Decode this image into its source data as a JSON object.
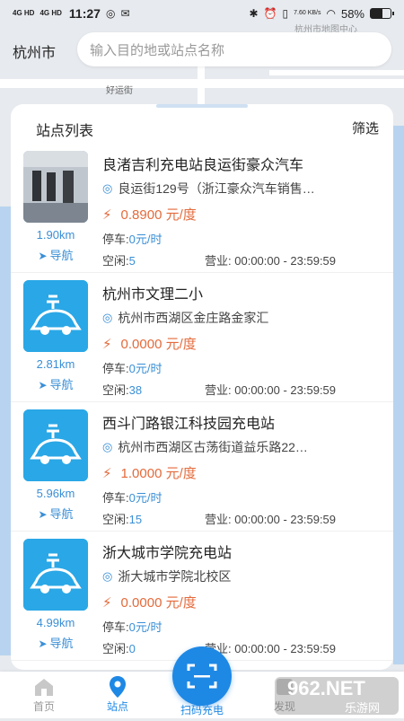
{
  "status": {
    "network1": "4G HD",
    "network2": "4G HD",
    "time": "11:27",
    "speed": "7.60 KB/s",
    "battery_text": "58%",
    "battery_level": 0.58
  },
  "header": {
    "city": "杭州市",
    "search_placeholder": "输入目的地或站点名称"
  },
  "map": {
    "labels": [
      "好运街",
      "杭州市地图中心"
    ]
  },
  "list": {
    "title": "站点列表",
    "filter": "筛选",
    "stations": [
      {
        "name": "良渚吉利充电站良运街豪众汽车",
        "address": "良运街129号（浙江豪众汽车销售…",
        "price": "0.8900 元/度",
        "distance": "1.90km",
        "nav_label": "导航",
        "parking_label": "停车:",
        "parking_value": "0元/时",
        "free_label": "空闲:",
        "free_value": "5",
        "hours_label": "营业:",
        "hours_value": "00:00:00 - 23:59:59",
        "thumb": "photo"
      },
      {
        "name": "杭州市文理二小",
        "address": "杭州市西湖区金庄路金家汇",
        "price": "0.0000 元/度",
        "distance": "2.81km",
        "nav_label": "导航",
        "parking_label": "停车:",
        "parking_value": "0元/时",
        "free_label": "空闲:",
        "free_value": "38",
        "hours_label": "营业:",
        "hours_value": "00:00:00 - 23:59:59",
        "thumb": "icon"
      },
      {
        "name": "西斗门路银江科技园充电站",
        "address": "杭州市西湖区古荡街道益乐路22…",
        "price": "1.0000 元/度",
        "distance": "5.96km",
        "nav_label": "导航",
        "parking_label": "停车:",
        "parking_value": "0元/时",
        "free_label": "空闲:",
        "free_value": "15",
        "hours_label": "营业:",
        "hours_value": "00:00:00 - 23:59:59",
        "thumb": "icon"
      },
      {
        "name": "浙大城市学院充电站",
        "address": "浙大城市学院北校区",
        "price": "0.0000 元/度",
        "distance": "4.99km",
        "nav_label": "导航",
        "parking_label": "停车:",
        "parking_value": "0元/时",
        "free_label": "空闲:",
        "free_value": "0",
        "hours_label": "营业:",
        "hours_value": "00:00:00 - 23:59:59",
        "thumb": "icon"
      }
    ]
  },
  "tabbar": {
    "home": "首页",
    "stations": "站点",
    "scan": "扫码充电",
    "discover": "发现",
    "watermark_top": "962.NET",
    "watermark_bottom": "乐游网"
  },
  "colors": {
    "accent": "#1e88e5",
    "price": "#e36a3b",
    "link": "#3a8fd6"
  }
}
